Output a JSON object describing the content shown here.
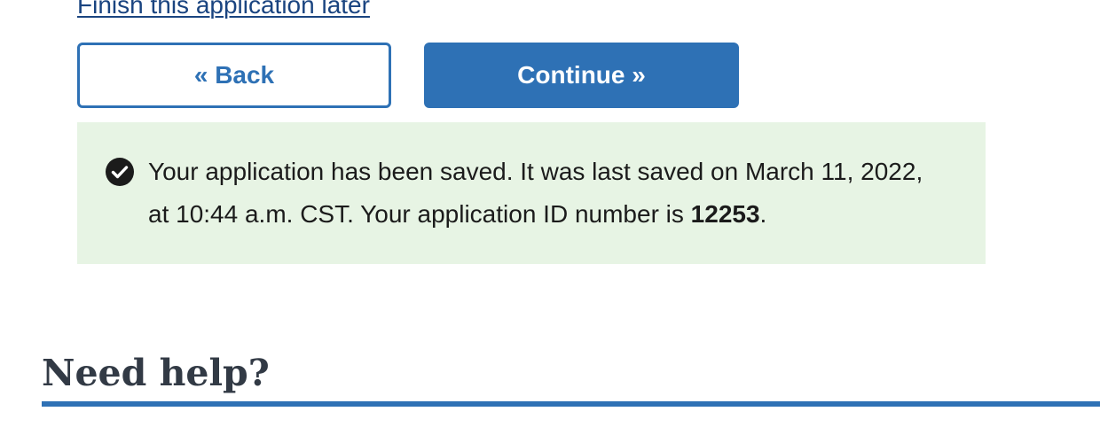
{
  "form_nav": {
    "finish_later_label": "Finish this application later",
    "back_label": "« Back",
    "continue_label": "Continue »"
  },
  "save_alert": {
    "icon": "check-circle-icon",
    "message_before": "Your application has been saved. It was last saved on March 11, 2022, at 10:44 a.m. CST. Your application ID number is ",
    "application_id": "12253",
    "message_after": "."
  },
  "help": {
    "heading": "Need help?"
  },
  "colors": {
    "primary": "#2e71b5",
    "link": "#1a4480",
    "success_bg": "#e7f4e4",
    "text": "#323a45"
  }
}
